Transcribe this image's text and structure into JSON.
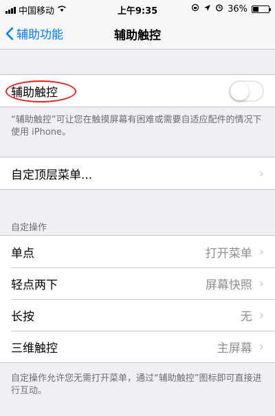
{
  "status_bar": {
    "carrier": "中国移动",
    "time": "上午9:35",
    "battery": "36%",
    "battery_level": 0.36
  },
  "nav": {
    "back_label": "辅助功能",
    "title": "辅助触控"
  },
  "assistive_touch": {
    "label": "辅助触控",
    "enabled": false,
    "note": "“辅助触控”可让您在触摸屏幕有困难或需要自适应配件的情况下使用 iPhone。"
  },
  "top_menu": {
    "label": "自定顶层菜单..."
  },
  "custom_actions": {
    "header": "自定操作",
    "items": [
      {
        "label": "单点",
        "value": "打开菜单"
      },
      {
        "label": "轻点两下",
        "value": "屏幕快照"
      },
      {
        "label": "长按",
        "value": "无"
      },
      {
        "label": "三维触控",
        "value": "主屏幕"
      }
    ],
    "note": "自定操作允许您无需打开菜单，通过“辅助触控”图标即可直接进行互动。"
  },
  "colors": {
    "accent": "#007aff",
    "highlight": "#e02222",
    "background": "#efeff4"
  }
}
